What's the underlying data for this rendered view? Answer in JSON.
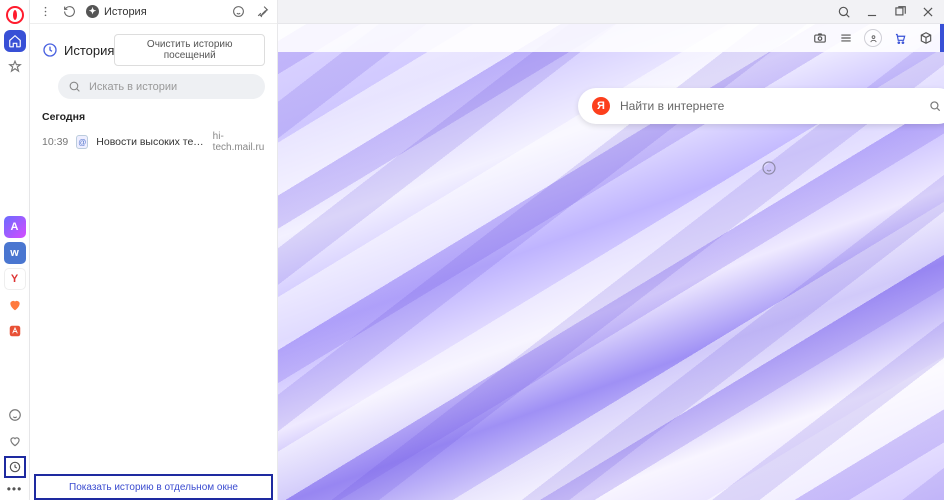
{
  "tab": {
    "title": "История"
  },
  "history_panel": {
    "title": "История",
    "clear_btn": "Очистить историю посещений",
    "search_placeholder": "Искать в истории",
    "sections": [
      {
        "label": "Сегодня",
        "items": [
          {
            "time": "10:39",
            "title": "Новости высоких технол…",
            "domain": "hi-tech.mail.ru"
          }
        ]
      }
    ],
    "open_full": "Показать историю в отдельном окне"
  },
  "rail_apps": {
    "a": "A",
    "vk": "w",
    "ya": "Y",
    "heart": "",
    "al": ""
  },
  "main_search": {
    "placeholder": "Найти в интернете",
    "engine_letter": "Я"
  },
  "icons": {
    "opera": "opera",
    "menu": "menu",
    "refresh": "refresh",
    "history": "history",
    "smile": "smile",
    "pin": "pin",
    "home": "home",
    "bookmark": "bookmark",
    "search": "search",
    "minimize": "minimize",
    "maximize": "maximize",
    "close": "close",
    "camera": "camera",
    "list": "list",
    "user": "user",
    "cart": "cart",
    "box": "box",
    "heart": "heart",
    "more": "more",
    "clock": "clock"
  }
}
